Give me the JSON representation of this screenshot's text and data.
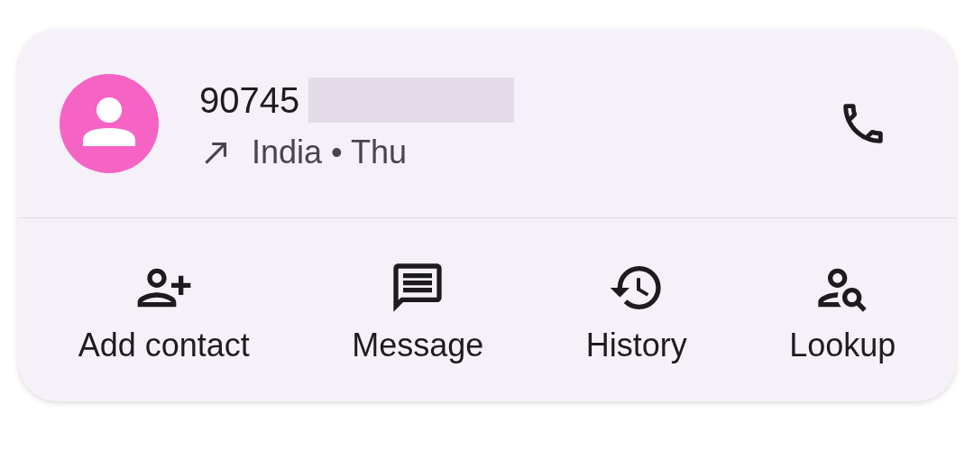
{
  "call": {
    "number": "90745",
    "redacted": true,
    "outgoing": true,
    "details": "India • Thu"
  },
  "actions": [
    {
      "kind": "add_contact",
      "label": "Add contact"
    },
    {
      "kind": "message",
      "label": "Message"
    },
    {
      "kind": "history",
      "label": "History"
    },
    {
      "kind": "lookup",
      "label": "Lookup"
    }
  ]
}
